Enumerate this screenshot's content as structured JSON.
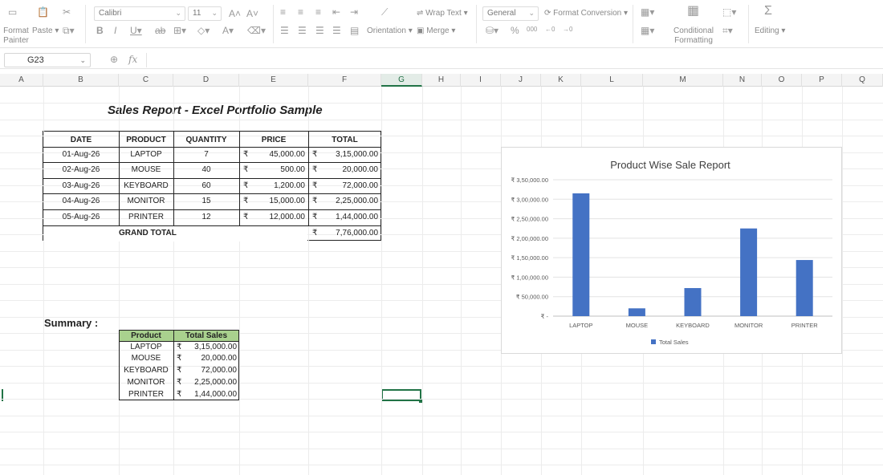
{
  "ribbon": {
    "format_painter": "Format Painter",
    "paste": "Paste",
    "font_name": "Calibri",
    "font_size": "11",
    "wrap_text": "Wrap Text",
    "orientation": "Orientation",
    "merge": "Merge",
    "number_format": "General",
    "format_conversion": "Format Conversion",
    "conditional_formatting": "Conditional Formatting",
    "editing": "Editing"
  },
  "formula_bar": {
    "cell_ref": "G23",
    "fx": "fx"
  },
  "columns": [
    "A",
    "B",
    "C",
    "D",
    "E",
    "F",
    "G",
    "H",
    "I",
    "J",
    "K",
    "L",
    "M",
    "N",
    "O",
    "P",
    "Q"
  ],
  "report": {
    "title": "Sales Report - Excel Portfolio Sample",
    "headers": [
      "DATE",
      "PRODUCT",
      "QUANTITY",
      "PRICE",
      "TOTAL"
    ],
    "currency": "₹",
    "rows": [
      {
        "date": "01-Aug-26",
        "product": "LAPTOP",
        "qty": "7",
        "price": "45,000.00",
        "total": "3,15,000.00"
      },
      {
        "date": "02-Aug-26",
        "product": "MOUSE",
        "qty": "40",
        "price": "500.00",
        "total": "20,000.00"
      },
      {
        "date": "03-Aug-26",
        "product": "KEYBOARD",
        "qty": "60",
        "price": "1,200.00",
        "total": "72,000.00"
      },
      {
        "date": "04-Aug-26",
        "product": "MONITOR",
        "qty": "15",
        "price": "15,000.00",
        "total": "2,25,000.00"
      },
      {
        "date": "05-Aug-26",
        "product": "PRINTER",
        "qty": "12",
        "price": "12,000.00",
        "total": "1,44,000.00"
      }
    ],
    "grand_total_label": "GRAND TOTAL",
    "grand_total": "7,76,000.00"
  },
  "summary": {
    "label": "Summary :",
    "headers": [
      "Product",
      "Total Sales"
    ],
    "header_color": "#a9d18e",
    "rows": [
      {
        "product": "LAPTOP",
        "total": "3,15,000.00"
      },
      {
        "product": "MOUSE",
        "total": "20,000.00"
      },
      {
        "product": "KEYBOARD",
        "total": "72,000.00"
      },
      {
        "product": "MONITOR",
        "total": "2,25,000.00"
      },
      {
        "product": "PRINTER",
        "total": "1,44,000.00"
      }
    ]
  },
  "chart_data": {
    "type": "bar",
    "title": "Product Wise Sale Report",
    "categories": [
      "LAPTOP",
      "MOUSE",
      "KEYBOARD",
      "MONITOR",
      "PRINTER"
    ],
    "series": [
      {
        "name": "Total Sales",
        "values": [
          315000,
          20000,
          72000,
          225000,
          144000
        ],
        "color": "#4472c4"
      }
    ],
    "ylim": [
      0,
      350000
    ],
    "y_ticks": [
      0,
      50000,
      100000,
      150000,
      200000,
      250000,
      300000,
      350000
    ],
    "y_tick_labels": [
      "₹ -",
      "₹ 50,000.00",
      "₹ 1,00,000.00",
      "₹ 1,50,000.00",
      "₹ 2,00,000.00",
      "₹ 2,50,000.00",
      "₹ 3,00,000.00",
      "₹ 3,50,000.00"
    ],
    "grid": true,
    "legend": "bottom"
  }
}
